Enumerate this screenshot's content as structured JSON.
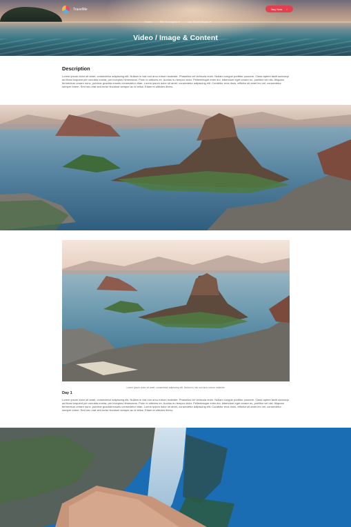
{
  "header": {
    "logo_text": "TravelMe",
    "cta_label": "Buy Now",
    "cta_arrow": "›",
    "nav": [
      "Home",
      "Site Examples ▾",
      "Use Some Blocks ▾"
    ]
  },
  "hero": {
    "title": "Video / Image & Content"
  },
  "description": {
    "heading": "Description",
    "body": "Lorem ipsum dolor sit amet, consectetur adipiscing elit. Nullam in nisi non arcu rutrum molestie. Phasellus vel vehicula enim. Nullam congue porttitor posuere. Class aptent taciti sociosqu ad litora torquent per conubia nostra, per inceptos himenaeos. Proin in ultricies ex. Auctus eu tempor dolor. Pellentesque enim dui, bibendum eget ornare eu, porttitor vel nisl. Aliquam fermentum ornare nunc, pulvinar gravida mauris consectetur vitae. Lorem ipsum dolor sit amet, consectetur adipiscing elit. Curabitur eros risus, efficitur sit amet leo vel, consectetur semper lorem. Sed nec erat sed tortor tincidunt semper ac id tellus. Etiam et ultricies libero."
  },
  "images": {
    "full_alt": "Rio de Janeiro bay panorama",
    "inset_alt": "Rio de Janeiro bay",
    "inset_caption": "Lorem ipsum dolor sit amet, consectetur adipiscing elit. Nullam in nisi non arcu rutrum molestie.",
    "bottom_alt": "Waterfall cliff"
  },
  "day": {
    "heading": "Day 1",
    "body": "Lorem ipsum dolor sit amet, consectetur adipiscing elit. Nullam in nisi non arcu rutrum molestie. Phasellus vel vehicula enim. Nullam congue porttitor posuere. Class aptent taciti sociosqu ad litora torquent per conubia nostra, per inceptos himenaeos. Proin in ultricies ex. Auctus eu tempor dolor. Pellentesque enim dui, bibendum eget ornare eu, porttitor vel nisl. Aliquam fermentum ornare nunc, pulvinar gravida mauris consectetur vitae. Lorem ipsum dolor sit amet, consectetur adipiscing elit. Curabitur eros risus, efficitur sit amet leo vel, consectetur semper lorem. Sed nec erat sed tortor tincidunt semper ac id tellus. Etiam et ultricies libero."
  },
  "colors": {
    "accent": "#e2404f",
    "heading": "#1e1e1e",
    "body_text": "#555555"
  }
}
